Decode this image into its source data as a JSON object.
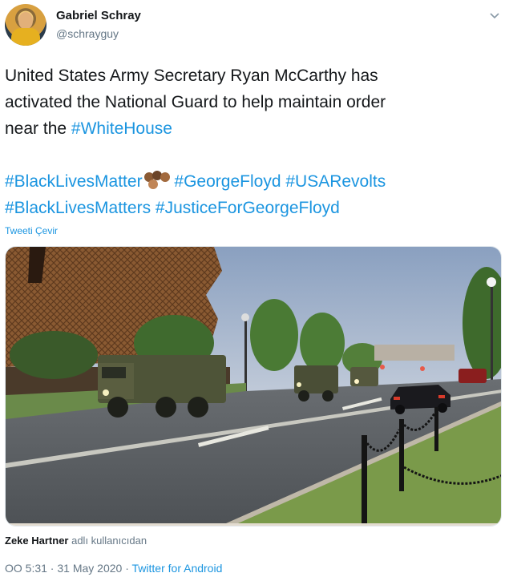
{
  "author": {
    "display_name": "Gabriel Schray",
    "handle": "@schrayguy"
  },
  "tweet": {
    "line1": "United States Army Secretary Ryan McCarthy has",
    "line2": "activated the National Guard to help maintain order",
    "line3_text": "near the ",
    "hashtag_whitehouse": "#WhiteHouse",
    "hashtag_blm": "#BlackLivesMatter",
    "hashtag_georgefloyd": "#GeorgeFloyd",
    "hashtag_usarevolts": "#USARevolts",
    "hashtag_blms": "#BlackLivesMatters",
    "hashtag_justice": "#JusticeForGeorgeFloyd"
  },
  "translate_label": "Tweeti Çevir",
  "media": {
    "description_icon": "video-thumbnail"
  },
  "attribution": {
    "user": "Zeke Hartner",
    "suffix": " adlı kullanıcıdan"
  },
  "meta": {
    "prefix": "OO ",
    "time": "5:31",
    "separator": " · ",
    "date": "31 May 2020",
    "separator2": " · ",
    "source": "Twitter for Android"
  },
  "colors": {
    "link": "#1b95e0",
    "secondary": "#657786",
    "text": "#14171a"
  }
}
